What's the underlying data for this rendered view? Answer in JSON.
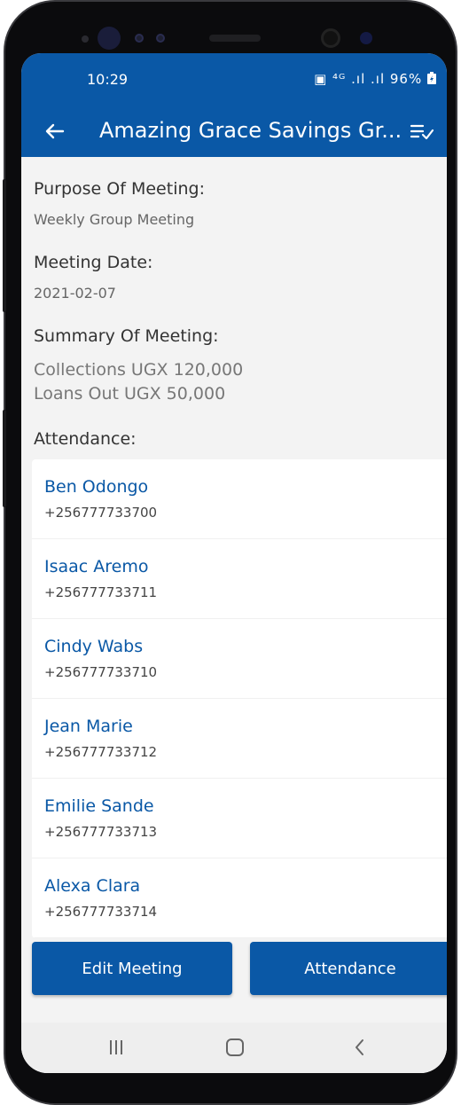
{
  "status_bar": {
    "time": "10:29",
    "icons_text": "▣ ⁴ᴳ .ıl .ıl 96%",
    "battery_icon": "battery-charging-icon"
  },
  "app_bar": {
    "title": "Amazing Grace Savings Gr...",
    "back_icon": "back-arrow-icon",
    "menu_icon": "sort-check-icon"
  },
  "meeting": {
    "purpose_label": "Purpose Of Meeting:",
    "purpose_value": "Weekly Group Meeting",
    "date_label": "Meeting Date:",
    "date_value": "2021-02-07",
    "summary_label": "Summary Of Meeting:",
    "summary_lines": [
      "Collections UGX 120,000",
      "Loans Out UGX 50,000"
    ],
    "attendance_label": "Attendance:"
  },
  "attendance": [
    {
      "name": "Ben Odongo",
      "phone": "+256777733700"
    },
    {
      "name": "Isaac Aremo",
      "phone": "+256777733711"
    },
    {
      "name": "Cindy Wabs",
      "phone": "+256777733710"
    },
    {
      "name": "Jean Marie",
      "phone": "+256777733712"
    },
    {
      "name": "Emilie Sande",
      "phone": "+256777733713"
    },
    {
      "name": "Alexa Clara",
      "phone": "+256777733714"
    }
  ],
  "buttons": {
    "edit_meeting": "Edit Meeting",
    "attendance": "Attendance"
  },
  "nav_bar": {
    "recent_icon": "recent-apps-icon",
    "home_icon": "home-icon",
    "back_icon": "nav-back-icon"
  },
  "colors": {
    "primary": "#0a58a6",
    "background": "#f3f3f3",
    "name_link": "#0a58a6"
  }
}
